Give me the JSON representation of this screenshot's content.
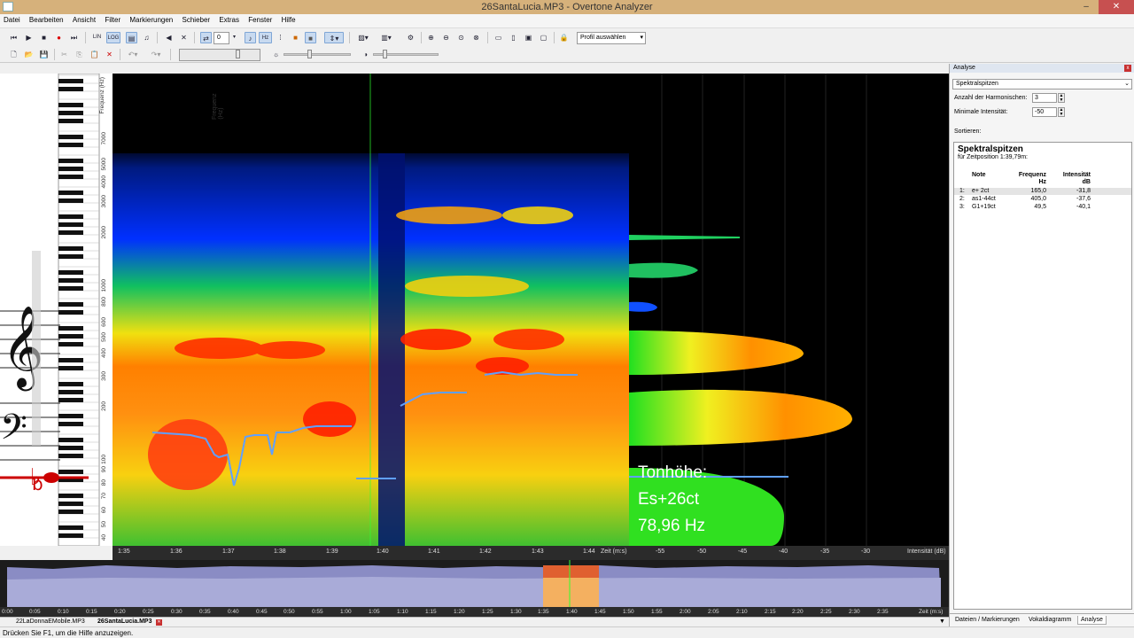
{
  "window": {
    "title": "26SantaLucia.MP3 - Overtone Analyzer",
    "minimize": "–",
    "maximize": "❐",
    "close": "✕"
  },
  "menu": [
    "Datei",
    "Bearbeiten",
    "Ansicht",
    "Filter",
    "Markierungen",
    "Schieber",
    "Extras",
    "Fenster",
    "Hilfe"
  ],
  "toolbar": {
    "lin_label": "LIN",
    "log_label": "LOG",
    "hz_label": "Hz",
    "count_value": "0",
    "profile_select": "Profil auswählen"
  },
  "spectrogram": {
    "freq_axis_label": "Frequenz (Hz)",
    "freq_ticks": [
      "7000",
      "5000",
      "4000",
      "3000",
      "2000",
      "1000",
      "800",
      "600",
      "500",
      "400",
      "300",
      "200",
      "100",
      "90",
      "80",
      "70",
      "60",
      "50",
      "40"
    ],
    "time_ticks": [
      "1:35",
      "1:36",
      "1:37",
      "1:38",
      "1:39",
      "1:40",
      "1:41",
      "1:42",
      "1:43",
      "1:44"
    ],
    "time_axis_label": "Zeit (m:s)",
    "readout": {
      "label": "Tonhöhe:",
      "note": "Es+26ct",
      "freq": "78,96 Hz"
    }
  },
  "spectrum": {
    "intensity_ticks": [
      "-55",
      "-50",
      "-45",
      "-40",
      "-35",
      "-30"
    ],
    "axis_label": "Intensität (dB)"
  },
  "overview": {
    "ticks": [
      "0:00",
      "0:05",
      "0:10",
      "0:15",
      "0:20",
      "0:25",
      "0:30",
      "0:35",
      "0:40",
      "0:45",
      "0:50",
      "0:55",
      "1:00",
      "1:05",
      "1:10",
      "1:15",
      "1:20",
      "1:25",
      "1:30",
      "1:35",
      "1:40",
      "1:45",
      "1:50",
      "1:55",
      "2:00",
      "2:05",
      "2:10",
      "2:15",
      "2:20",
      "2:25",
      "2:30",
      "2:35"
    ],
    "axis_label": "Zeit (m:s)"
  },
  "file_tabs": [
    "22LaDonnaEMobile.MP3",
    "26SantaLucia.MP3"
  ],
  "file_tab_close": "✕",
  "status": "Drücken Sie F1, um die Hilfe anzuzeigen.",
  "analysis_panel": {
    "title": "Analyse",
    "close": "x",
    "mode": "Spektralspitzen",
    "harmonics_label": "Anzahl der Harmonischen:",
    "harmonics_value": "3",
    "intensity_label": "Minimale Intensität:",
    "intensity_value": "-50",
    "sort_label": "Sortieren:",
    "result_title": "Spektralspitzen",
    "result_sub": "für Zeitposition 1:39,79m:",
    "col_note": "Note",
    "col_freq": "Frequenz",
    "col_freq_unit": "Hz",
    "col_int": "Intensität",
    "col_int_unit": "dB",
    "rows": [
      {
        "idx": "1:",
        "note": "e+ 2ct",
        "freq": "165,0",
        "int": "-31,8"
      },
      {
        "idx": "2:",
        "note": "as1-44ct",
        "freq": "405,0",
        "int": "-37,6"
      },
      {
        "idx": "3:",
        "note": "G1+19ct",
        "freq": "49,5",
        "int": "-40,1"
      }
    ],
    "tabs": [
      "Dateien / Markierungen",
      "Vokaldiagramm",
      "Analyse"
    ]
  }
}
